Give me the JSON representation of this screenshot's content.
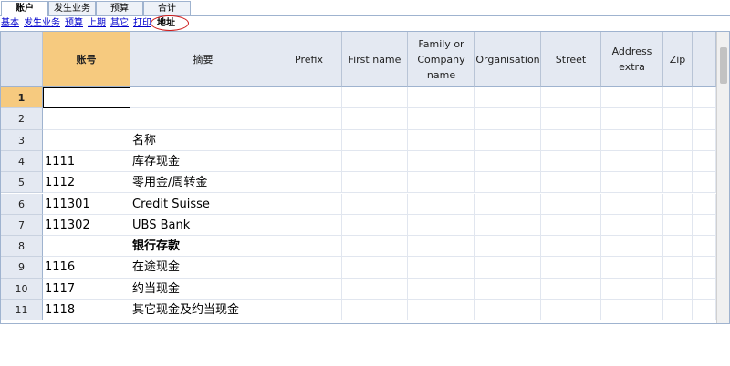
{
  "tabs": [
    {
      "label": "账户",
      "active": true
    },
    {
      "label": "发生业务",
      "active": false
    },
    {
      "label": "预算",
      "active": false
    },
    {
      "label": "合计",
      "active": false
    }
  ],
  "views": [
    {
      "label": "基本",
      "active": false
    },
    {
      "label": "发生业务",
      "active": false
    },
    {
      "label": "预算",
      "active": false
    },
    {
      "label": "上期",
      "active": false
    },
    {
      "label": "其它",
      "active": false
    },
    {
      "label": "打印",
      "active": false
    },
    {
      "label": "地址",
      "active": true
    }
  ],
  "columns": [
    "账号",
    "摘要",
    "Prefix",
    "First name",
    "Family or Company name",
    "Organisation",
    "Street",
    "Address extra",
    "Zip"
  ],
  "rows": [
    {
      "num": "1",
      "account": "",
      "description": "",
      "bold": false
    },
    {
      "num": "2",
      "account": "",
      "description": "",
      "bold": false
    },
    {
      "num": "3",
      "account": "",
      "description": "名称",
      "bold": false
    },
    {
      "num": "4",
      "account": "1111",
      "description": "库存现金",
      "bold": false
    },
    {
      "num": "5",
      "account": "1112",
      "description": "零用金/周转金",
      "bold": false
    },
    {
      "num": "6",
      "account": "111301",
      "description": "Credit Suisse",
      "bold": false
    },
    {
      "num": "7",
      "account": "111302",
      "description": "UBS Bank",
      "bold": false
    },
    {
      "num": "8",
      "account": "",
      "description": "银行存款",
      "bold": true
    },
    {
      "num": "9",
      "account": "1116",
      "description": "在途现金",
      "bold": false
    },
    {
      "num": "10",
      "account": "1117",
      "description": "约当现金",
      "bold": false
    },
    {
      "num": "11",
      "account": "1118",
      "description": "其它现金及约当现金",
      "bold": false
    }
  ],
  "colors": {
    "accent": "#f6ca7f",
    "header": "#e4e9f2",
    "highlight_circle": "#cc1a1a",
    "link": "#0000cc"
  }
}
